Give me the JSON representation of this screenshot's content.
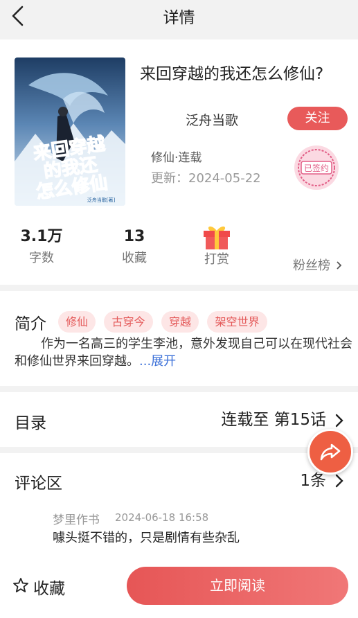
{
  "header": {
    "title": "详情"
  },
  "book": {
    "title": "来回穿越的我还怎么修仙?",
    "author": "泛舟当歌",
    "follow_label": "关注",
    "genre": "修仙·连载",
    "updated": "更新：2024-05-22",
    "signed_label": "已签约",
    "cover_text": [
      "来回穿越",
      "的我还",
      "怎么修仙"
    ],
    "cover_small": "泛舟当歌[著]"
  },
  "stats": {
    "words_value": "3.1万",
    "words_label": "字数",
    "favorites_value": "13",
    "favorites_label": "收藏",
    "tip_label": "打赏",
    "fans_label": "粉丝榜"
  },
  "intro": {
    "title": "简介",
    "tags": [
      "修仙",
      "古穿今",
      "穿越",
      "架空世界"
    ],
    "text": "作为一名高三的学生李池，意外发现自己可以在现代社会和修仙世界来回穿越。",
    "expand_label": "...展开"
  },
  "toc": {
    "label": "目录",
    "status": "连载至 第15话"
  },
  "comments": {
    "label": "评论区",
    "count": "1条",
    "items": [
      {
        "user": "梦里作书",
        "time": "2024-06-18 16:58",
        "text": "噱头挺不错的，只是剧情有些杂乱"
      }
    ]
  },
  "bottom": {
    "collect_label": "收藏",
    "read_label": "立即阅读"
  },
  "colors": {
    "accent": "#e85a5a",
    "tag_bg": "#fde6e6",
    "link": "#3a6fd8",
    "share": "#ee5f43"
  }
}
